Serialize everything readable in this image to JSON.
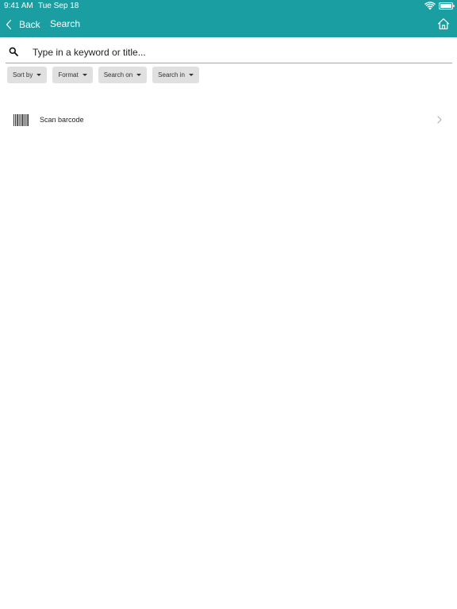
{
  "status_bar": {
    "time": "9:41 AM",
    "date": "Tue Sep 18"
  },
  "nav": {
    "back_label": "Back",
    "title": "Search",
    "home_icon": "home-icon"
  },
  "search": {
    "placeholder": "Type in a keyword or title...",
    "value": "",
    "icon": "search-icon"
  },
  "filters": [
    {
      "label": "Sort by"
    },
    {
      "label": "Format"
    },
    {
      "label": "Search on"
    },
    {
      "label": "Search in"
    }
  ],
  "scan": {
    "label": "Scan barcode",
    "icon": "barcode-icon"
  },
  "colors": {
    "header": "#1a9ea1",
    "chip_bg": "#e0e0e0"
  }
}
